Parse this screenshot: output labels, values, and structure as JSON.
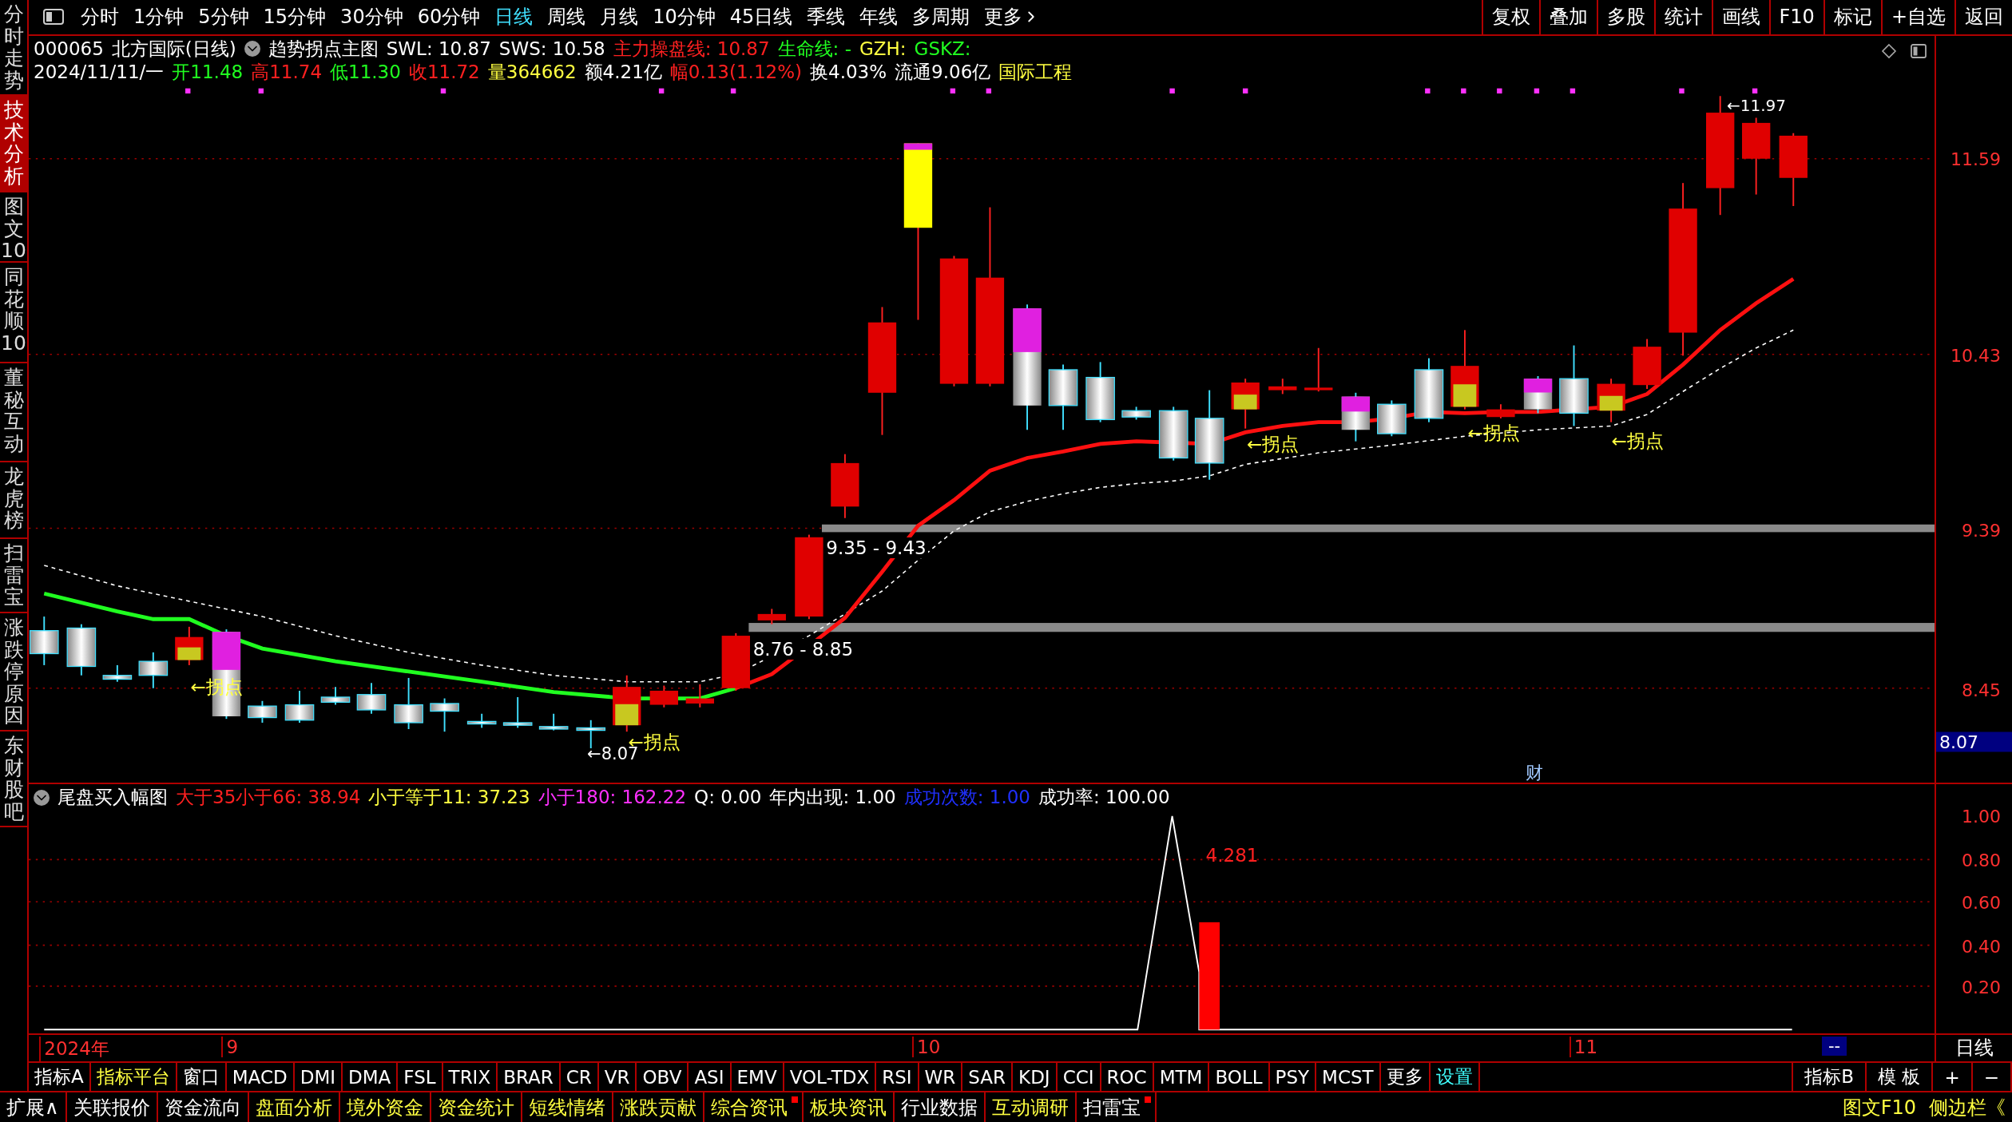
{
  "sidebar": {
    "tabs": [
      {
        "label": "分时走势",
        "selected": false
      },
      {
        "label": "技术分析",
        "selected": true
      },
      {
        "label": "图文10",
        "selected": false
      },
      {
        "label": "同花顺10",
        "selected": false
      },
      {
        "label": "董秘互动",
        "selected": false
      },
      {
        "label": "龙虎榜",
        "selected": false
      },
      {
        "label": "扫雷宝",
        "selected": false
      },
      {
        "label": "涨跌停原因",
        "selected": false
      },
      {
        "label": "东财股吧",
        "selected": false
      }
    ]
  },
  "period_toolbar": {
    "items": [
      {
        "label": "分时",
        "selected": false
      },
      {
        "label": "1分钟",
        "selected": false
      },
      {
        "label": "5分钟",
        "selected": false
      },
      {
        "label": "15分钟",
        "selected": false
      },
      {
        "label": "30分钟",
        "selected": false
      },
      {
        "label": "60分钟",
        "selected": false
      },
      {
        "label": "日线",
        "selected": true
      },
      {
        "label": "周线",
        "selected": false
      },
      {
        "label": "月线",
        "selected": false
      },
      {
        "label": "10分钟",
        "selected": false
      },
      {
        "label": "45日线",
        "selected": false
      },
      {
        "label": "季线",
        "selected": false
      },
      {
        "label": "年线",
        "selected": false
      },
      {
        "label": "多周期",
        "selected": false
      }
    ],
    "more": "更多"
  },
  "tools": [
    "复权",
    "叠加",
    "多股",
    "统计",
    "画线",
    "F10",
    "标记",
    "+自选",
    "返回"
  ],
  "quote_header": {
    "code": "000065",
    "name": "北方国际(日线)",
    "indicator": "趋势拐点主图",
    "values": [
      {
        "text": "SWL: 10.87",
        "color": "#ffffff"
      },
      {
        "text": "SWS: 10.58",
        "color": "#ffffff"
      },
      {
        "text": "主力操盘线: 10.87",
        "color": "#ff2020"
      },
      {
        "text": "生命线: -",
        "color": "#20ff20"
      },
      {
        "text": "GZH:",
        "color": "#ffff40"
      },
      {
        "text": "GSKZ:",
        "color": "#20ff20"
      }
    ],
    "date": "2024/11/11/一",
    "quotes": [
      {
        "text": "开11.48",
        "color": "#20ff20"
      },
      {
        "text": "高11.74",
        "color": "#ff2020"
      },
      {
        "text": "低11.30",
        "color": "#20ff20"
      },
      {
        "text": "收11.72",
        "color": "#ff2020"
      },
      {
        "text": "量364662",
        "color": "#ffff40"
      },
      {
        "text": "额4.21亿",
        "color": "#ffffff"
      },
      {
        "text": "幅0.13(1.12%)",
        "color": "#ff2020"
      },
      {
        "text": "换4.03%",
        "color": "#ffffff"
      },
      {
        "text": "流通9.06亿",
        "color": "#ffffff"
      },
      {
        "text": "国际工程",
        "color": "#ffff40"
      }
    ]
  },
  "main_chart": {
    "price_labels": [
      "11.59",
      "10.43",
      "9.39",
      "8.45"
    ],
    "current_price": "8.07",
    "zones": [
      {
        "label": "9.35 - 9.43"
      },
      {
        "label": "8.76 - 8.85"
      }
    ],
    "markers": [
      {
        "text": "←拐点"
      },
      {
        "text": "←拐点"
      },
      {
        "text": "←拐点"
      },
      {
        "text": "←拐点"
      },
      {
        "text": "←拐点"
      }
    ],
    "low_label": "←8.07",
    "high_label": "←11.97",
    "news_mark": "财"
  },
  "indicator_panel": {
    "name": "尾盘买入幅图",
    "values": [
      {
        "text": "大于35小于66: 38.94",
        "color": "#ff2020"
      },
      {
        "text": "小于等于11: 37.23",
        "color": "#ffff40"
      },
      {
        "text": "小于180: 162.22",
        "color": "#ff30ff"
      },
      {
        "text": "Q: 0.00",
        "color": "#ffffff"
      },
      {
        "text": "年内出现: 1.00",
        "color": "#ffffff"
      },
      {
        "text": "成功次数: 1.00",
        "color": "#2030ff"
      },
      {
        "text": "成功率: 100.00",
        "color": "#ffffff"
      }
    ],
    "value_label": "4.281",
    "axis_labels": [
      "1.00",
      "0.80",
      "0.60",
      "0.40",
      "0.20"
    ]
  },
  "date_axis": {
    "labels": [
      "2024年",
      "9",
      "10",
      "11"
    ],
    "cursor": "--",
    "period": "日线"
  },
  "indicator_tabs": {
    "items": [
      {
        "label": "指标A",
        "kind": "indicator"
      },
      {
        "label": "指标平台",
        "kind": "platform"
      },
      {
        "label": "窗口",
        "kind": "indicator"
      },
      {
        "label": "MACD",
        "kind": "indicator"
      },
      {
        "label": "DMI",
        "kind": "indicator"
      },
      {
        "label": "DMA",
        "kind": "indicator"
      },
      {
        "label": "FSL",
        "kind": "indicator"
      },
      {
        "label": "TRIX",
        "kind": "indicator"
      },
      {
        "label": "BRAR",
        "kind": "indicator"
      },
      {
        "label": "CR",
        "kind": "indicator"
      },
      {
        "label": "VR",
        "kind": "indicator"
      },
      {
        "label": "OBV",
        "kind": "indicator"
      },
      {
        "label": "ASI",
        "kind": "indicator"
      },
      {
        "label": "EMV",
        "kind": "indicator"
      },
      {
        "label": "VOL-TDX",
        "kind": "indicator"
      },
      {
        "label": "RSI",
        "kind": "indicator"
      },
      {
        "label": "WR",
        "kind": "indicator"
      },
      {
        "label": "SAR",
        "kind": "indicator"
      },
      {
        "label": "KDJ",
        "kind": "indicator"
      },
      {
        "label": "CCI",
        "kind": "indicator"
      },
      {
        "label": "ROC",
        "kind": "indicator"
      },
      {
        "label": "MTM",
        "kind": "indicator"
      },
      {
        "label": "BOLL",
        "kind": "indicator"
      },
      {
        "label": "PSY",
        "kind": "indicator"
      },
      {
        "label": "MCST",
        "kind": "indicator"
      },
      {
        "label": "更多",
        "kind": "indicator"
      },
      {
        "label": "设置",
        "kind": "settings"
      }
    ],
    "right": [
      "指标B",
      "模 板",
      "+",
      "−"
    ]
  },
  "bottom_bar": {
    "items": [
      {
        "label": "扩展∧",
        "color": "#ffffff",
        "badge": false
      },
      {
        "label": "关联报价",
        "color": "#ffffff",
        "badge": false
      },
      {
        "label": "资金流向",
        "color": "#ffffff",
        "badge": false
      },
      {
        "label": "盘面分析",
        "color": "#ffff40",
        "badge": false
      },
      {
        "label": "境外资金",
        "color": "#ffff40",
        "badge": false
      },
      {
        "label": "资金统计",
        "color": "#ffff40",
        "badge": false
      },
      {
        "label": "短线情绪",
        "color": "#ffff40",
        "badge": false
      },
      {
        "label": "涨跌贡献",
        "color": "#ffff40",
        "badge": false
      },
      {
        "label": "综合资讯",
        "color": "#ffff40",
        "badge": true
      },
      {
        "label": "板块资讯",
        "color": "#ffff40",
        "badge": false
      },
      {
        "label": "行业数据",
        "color": "#ffffff",
        "badge": false
      },
      {
        "label": "互动调研",
        "color": "#ffff40",
        "badge": false
      },
      {
        "label": "扫雷宝",
        "color": "#ffffff",
        "badge": true
      }
    ],
    "right": [
      "图文F10",
      "侧边栏《"
    ]
  }
}
